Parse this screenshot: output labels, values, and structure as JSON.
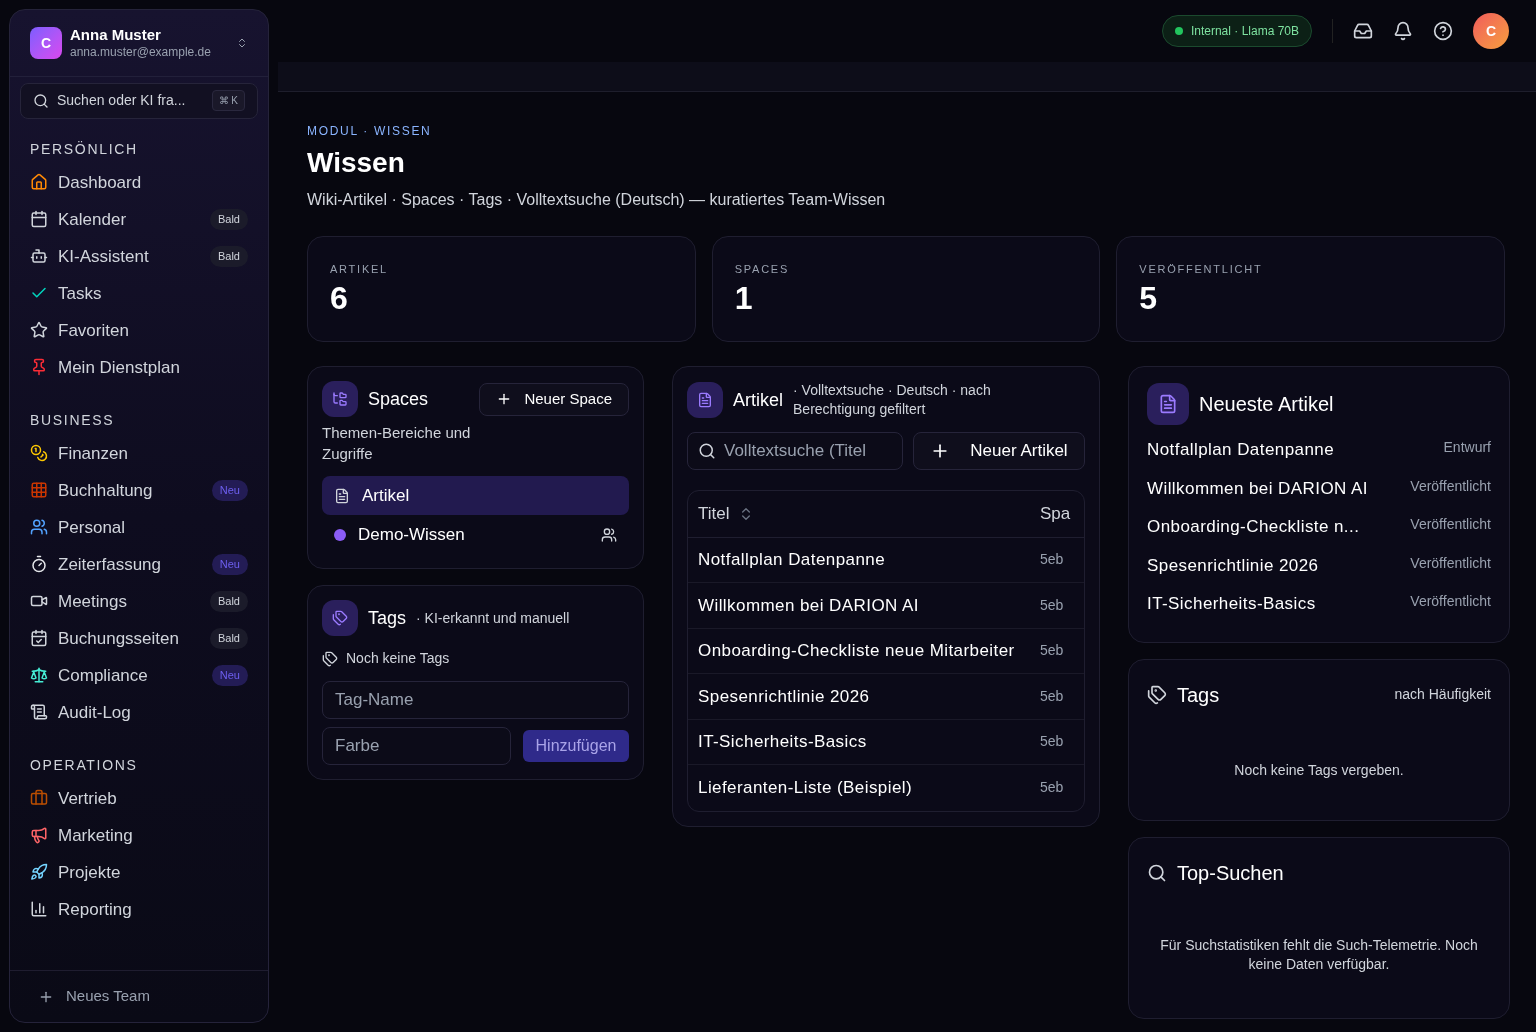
{
  "account": {
    "avatar": "C",
    "name": "Anna Muster",
    "email": "anna.muster@example.de"
  },
  "sidebar_search": {
    "placeholder": "Suchen oder KI fra...",
    "shortcut": "⌘ K"
  },
  "sidebar": {
    "sections": [
      {
        "title": "PERSÖNLICH",
        "items": [
          {
            "label": "Dashboard"
          },
          {
            "label": "Kalender",
            "badge": "Bald",
            "kind": "soon"
          },
          {
            "label": "KI-Assistent",
            "badge": "Bald",
            "kind": "soon"
          },
          {
            "label": "Tasks"
          },
          {
            "label": "Favoriten"
          },
          {
            "label": "Mein Dienstplan"
          }
        ]
      },
      {
        "title": "BUSINESS",
        "items": [
          {
            "label": "Finanzen"
          },
          {
            "label": "Buchhaltung",
            "badge": "Neu",
            "kind": "new"
          },
          {
            "label": "Personal"
          },
          {
            "label": "Zeiterfassung",
            "badge": "Neu",
            "kind": "new"
          },
          {
            "label": "Meetings",
            "badge": "Bald",
            "kind": "soon"
          },
          {
            "label": "Buchungsseiten",
            "badge": "Bald",
            "kind": "soon"
          },
          {
            "label": "Compliance",
            "badge": "Neu",
            "kind": "new"
          },
          {
            "label": "Audit-Log"
          }
        ]
      },
      {
        "title": "OPERATIONS",
        "items": [
          {
            "label": "Vertrieb"
          },
          {
            "label": "Marketing"
          },
          {
            "label": "Projekte"
          },
          {
            "label": "Reporting"
          }
        ]
      }
    ],
    "footer": "Neues Team"
  },
  "topbar": {
    "model_badge": "Internal · Llama 70B",
    "avatar": "C"
  },
  "header": {
    "eyebrow": "MODUL · WISSEN",
    "title": "Wissen",
    "subtitle": "Wiki-Artikel · Spaces · Tags · Volltextsuche (Deutsch) — kuratiertes Team-Wissen"
  },
  "stats": [
    {
      "label": "ARTIKEL",
      "value": "6"
    },
    {
      "label": "SPACES",
      "value": "1"
    },
    {
      "label": "VERÖFFENTLICHT",
      "value": "5"
    }
  ],
  "spaces": {
    "title": "Spaces",
    "subtitle": "Themen-Bereiche und Zugriffe",
    "button": "Neuer Space",
    "items": [
      {
        "label": "Artikel",
        "kind": "all",
        "selected": true
      },
      {
        "label": "Demo-Wissen",
        "kind": "space",
        "color": "#8b5cf6",
        "selected": false
      }
    ]
  },
  "tags_panel": {
    "title": "Tags",
    "subtitle": "· KI-erkannt und manuell",
    "empty": "Noch keine Tags",
    "name_placeholder": "Tag-Name",
    "color_placeholder": "Farbe",
    "button": "Hinzufügen"
  },
  "articles": {
    "title": "Artikel",
    "subtitle": "· Volltextsuche · Deutsch · nach Berechtigung gefiltert",
    "search_placeholder": "Volltextsuche (Titel",
    "button": "Neuer Artikel",
    "columns": [
      "Titel",
      "Spa"
    ],
    "rows": [
      [
        "Notfallplan Datenpanne",
        "5eb"
      ],
      [
        "Willkommen bei DARION AI",
        "5eb"
      ],
      [
        "Onboarding-Checkliste neue Mitarbeiter",
        "5eb"
      ],
      [
        "Spesenrichtlinie 2026",
        "5eb"
      ],
      [
        "IT-Sicherheits-Basics",
        "5eb"
      ],
      [
        "Lieferanten-Liste (Beispiel)",
        "5eb"
      ]
    ]
  },
  "latest": {
    "title": "Neueste Artikel",
    "items": [
      {
        "title": "Notfallplan Datenpanne",
        "status": "Entwurf"
      },
      {
        "title": "Willkommen bei DARION AI",
        "status": "Veröffentlicht"
      },
      {
        "title": "Onboarding-Checkliste n...",
        "status": "Veröffentlicht"
      },
      {
        "title": "Spesenrichtlinie 2026",
        "status": "Veröffentlicht"
      },
      {
        "title": "IT-Sicherheits-Basics",
        "status": "Veröffentlicht"
      }
    ]
  },
  "tag_cloud": {
    "title": "Tags",
    "note": "nach Häufigkeit",
    "empty": "Noch keine Tags vergeben."
  },
  "top_searches": {
    "title": "Top-Suchen",
    "empty": "Für Suchstatistiken fehlt die Such-Telemetrie. Noch keine Daten verfügbar."
  }
}
